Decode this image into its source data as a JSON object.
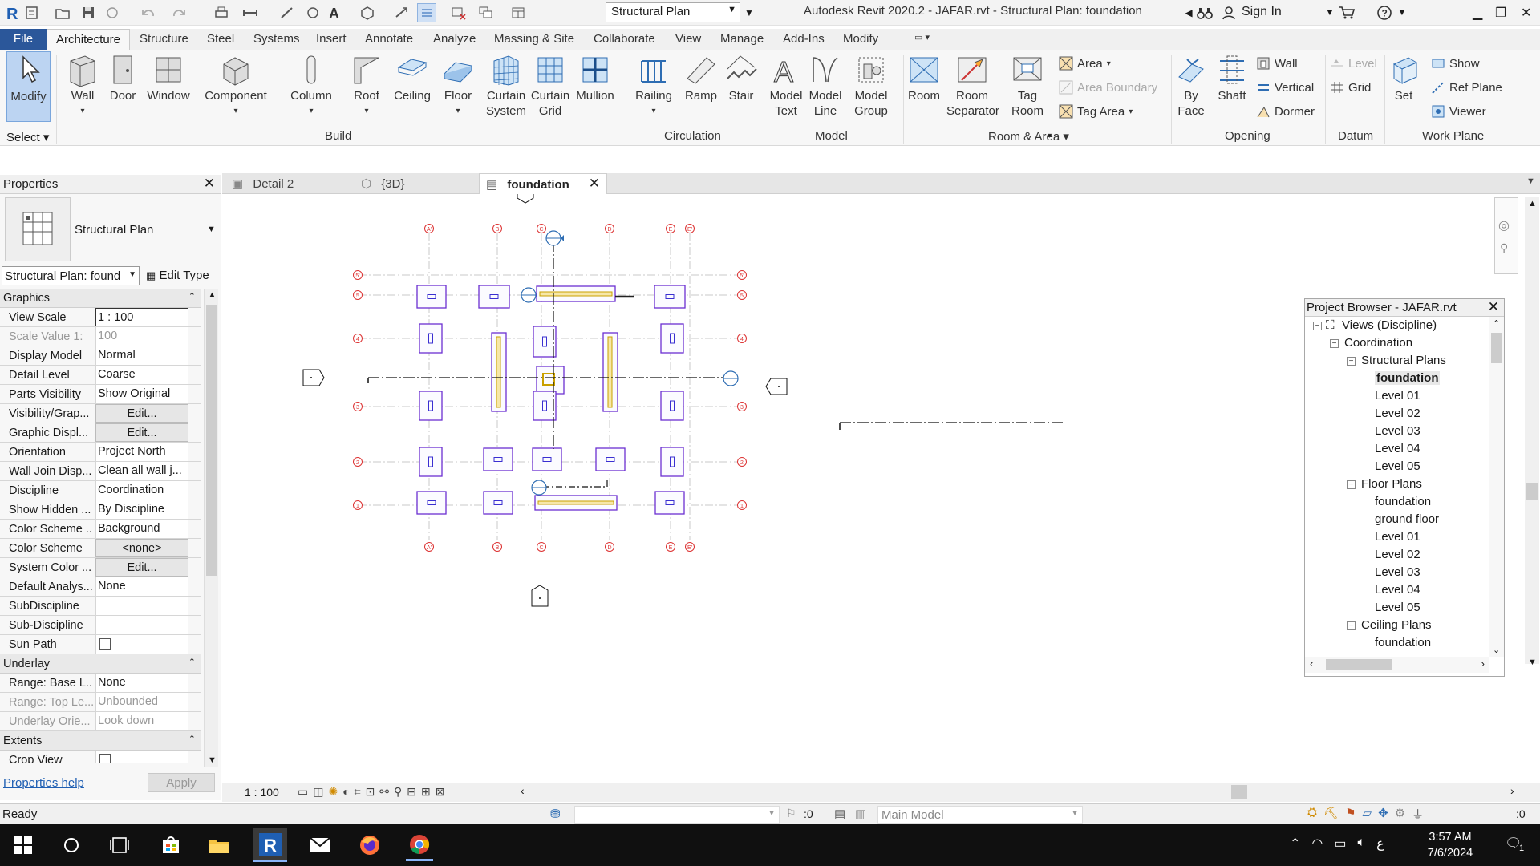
{
  "app": {
    "title": "Autodesk Revit 2020.2 - JAFAR.rvt - Structural Plan: foundation",
    "view_type_dropdown": "Structural Plan",
    "sign_in": "Sign In",
    "accent": "#2b579a"
  },
  "menu": {
    "tabs": [
      "File",
      "Architecture",
      "Structure",
      "Steel",
      "Systems",
      "Insert",
      "Annotate",
      "Analyze",
      "Massing & Site",
      "Collaborate",
      "View",
      "Manage",
      "Add-Ins",
      "Modify"
    ]
  },
  "ribbon": {
    "modify": "Modify",
    "select": "Select",
    "build": {
      "label": "Build",
      "tools": [
        "Wall",
        "Door",
        "Window",
        "Component",
        "Column",
        "Roof",
        "Ceiling",
        "Floor",
        "Curtain System",
        "Curtain Grid",
        "Mullion"
      ]
    },
    "circulation": {
      "label": "Circulation",
      "tools": [
        "Railing",
        "Ramp",
        "Stair"
      ]
    },
    "model": {
      "label": "Model",
      "tools": [
        "Model Text",
        "Model Line",
        "Model Group"
      ]
    },
    "room_area": {
      "label": "Room & Area",
      "tools": [
        "Room",
        "Room Separator",
        "Tag Room"
      ],
      "small": [
        "Area",
        "Area Boundary",
        "Tag Area"
      ]
    },
    "opening": {
      "label": "Opening",
      "tools": [
        "By Face",
        "Shaft"
      ],
      "small": [
        "Wall",
        "Vertical",
        "Dormer"
      ]
    },
    "datum": {
      "label": "Datum",
      "small": [
        "Level",
        "Grid"
      ]
    },
    "work_plane": {
      "label": "Work Plane",
      "tools": [
        "Set"
      ],
      "small": [
        "Show",
        "Ref  Plane",
        "Viewer"
      ]
    }
  },
  "properties": {
    "title": "Properties",
    "type_name": "Structural Plan",
    "instance_selector": "Structural Plan: found",
    "edit_type": "Edit Type",
    "groups": {
      "graphics": "Graphics",
      "underlay": "Underlay",
      "extents": "Extents"
    },
    "graphics_rows": [
      {
        "k": "View Scale",
        "v": "1 : 100"
      },
      {
        "k": "Scale Value    1:",
        "v": "100",
        "disabled": true
      },
      {
        "k": "Display Model",
        "v": "Normal"
      },
      {
        "k": "Detail Level",
        "v": "Coarse"
      },
      {
        "k": "Parts Visibility",
        "v": "Show Original"
      },
      {
        "k": "Visibility/Grap...",
        "v": "Edit...",
        "button": true
      },
      {
        "k": "Graphic Displ...",
        "v": "Edit...",
        "button": true
      },
      {
        "k": "Orientation",
        "v": "Project North"
      },
      {
        "k": "Wall Join Disp...",
        "v": "Clean all wall j..."
      },
      {
        "k": "Discipline",
        "v": "Coordination"
      },
      {
        "k": "Show Hidden ...",
        "v": "By Discipline"
      },
      {
        "k": "Color Scheme ...",
        "v": "Background"
      },
      {
        "k": "Color Scheme",
        "v": "<none>",
        "button": true
      },
      {
        "k": "System Color ...",
        "v": "Edit...",
        "button": true
      },
      {
        "k": "Default Analys...",
        "v": "None"
      },
      {
        "k": "SubDiscipline",
        "v": ""
      },
      {
        "k": "Sub-Discipline",
        "v": ""
      },
      {
        "k": "Sun Path",
        "v": "",
        "checkbox": true
      }
    ],
    "underlay_rows": [
      {
        "k": "Range: Base L...",
        "v": "None"
      },
      {
        "k": "Range: Top Le...",
        "v": "Unbounded",
        "disabled": true
      },
      {
        "k": "Underlay Orie...",
        "v": "Look down",
        "disabled": true
      }
    ],
    "extents_rows": [
      {
        "k": "Crop View",
        "v": "",
        "checkbox": true
      }
    ],
    "help_link": "Properties help",
    "apply": "Apply"
  },
  "view_tabs": [
    {
      "label": "Detail 2"
    },
    {
      "label": "{3D}"
    },
    {
      "label": "foundation",
      "active": true
    }
  ],
  "plan": {
    "grid_columns": [
      "A'",
      "B",
      "C",
      "D",
      "E",
      "E'"
    ],
    "grid_rows": [
      "5'",
      "5",
      "4",
      "3",
      "2",
      "1"
    ]
  },
  "project_browser": {
    "title": "Project Browser - JAFAR.rvt",
    "tree": [
      {
        "label": "Views (Discipline)",
        "level": 0,
        "toggle": "-"
      },
      {
        "label": "Coordination",
        "level": 1,
        "toggle": "-"
      },
      {
        "label": "Structural Plans",
        "level": 2,
        "toggle": "-"
      },
      {
        "label": "foundation",
        "level": 3,
        "selected": true
      },
      {
        "label": "Level 01",
        "level": 3
      },
      {
        "label": "Level 02",
        "level": 3
      },
      {
        "label": "Level 03",
        "level": 3
      },
      {
        "label": "Level 04",
        "level": 3
      },
      {
        "label": "Level 05",
        "level": 3
      },
      {
        "label": "Floor Plans",
        "level": 2,
        "toggle": "-"
      },
      {
        "label": "foundation",
        "level": 3
      },
      {
        "label": "ground floor",
        "level": 3
      },
      {
        "label": "Level 01",
        "level": 3
      },
      {
        "label": "Level 02",
        "level": 3
      },
      {
        "label": "Level 03",
        "level": 3
      },
      {
        "label": "Level 04",
        "level": 3
      },
      {
        "label": "Level 05",
        "level": 3
      },
      {
        "label": "Ceiling Plans",
        "level": 2,
        "toggle": "-"
      },
      {
        "label": "foundation",
        "level": 3
      }
    ]
  },
  "view_control": {
    "scale": "1 : 100"
  },
  "status": {
    "text": "Ready",
    "workset_count": ":0",
    "design_option": "Main Model",
    "filter_count": ":0"
  },
  "taskbar": {
    "time": "3:57 AM",
    "date": "7/6/2024",
    "lang": "ع",
    "notifications": "1"
  }
}
